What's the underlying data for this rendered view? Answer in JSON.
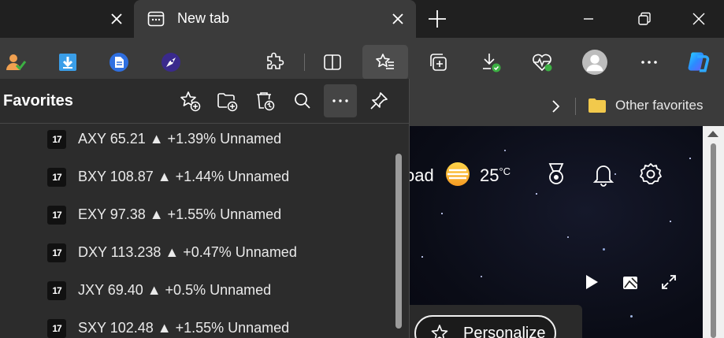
{
  "tabs": {
    "active_title": "New tab"
  },
  "bookmarks_bar": {
    "other_favorites": "Other favorites"
  },
  "favorites": {
    "title": "Favorites",
    "items": [
      {
        "label": "AXY 65.21 ▲ +1.39% Unnamed",
        "icon": "tradingview-icon",
        "icon_text": "17"
      },
      {
        "label": "BXY 108.87 ▲ +1.44% Unnamed",
        "icon": "tradingview-icon",
        "icon_text": "17"
      },
      {
        "label": "EXY 97.38 ▲ +1.55% Unnamed",
        "icon": "tradingview-icon",
        "icon_text": "17"
      },
      {
        "label": "DXY 113.238 ▲ +0.47% Unnamed",
        "icon": "tradingview-icon",
        "icon_text": "17"
      },
      {
        "label": "JXY 69.40 ▲ +0.5% Unnamed",
        "icon": "tradingview-icon",
        "icon_text": "17"
      },
      {
        "label": "SXY 102.48 ▲ +1.55% Unnamed",
        "icon": "tradingview-icon",
        "icon_text": "17"
      }
    ]
  },
  "newtab_page": {
    "partial_text": "oad",
    "temperature": "25",
    "temp_unit": "°C",
    "personalize_label": "Personalize"
  },
  "colors": {
    "toolbar_bg": "#3b3b3b",
    "panel_bg": "#2c2c2c",
    "tabstrip_bg": "#202020",
    "folder_yellow": "#f2c94c",
    "copilot_blue": "#2a8cff"
  }
}
